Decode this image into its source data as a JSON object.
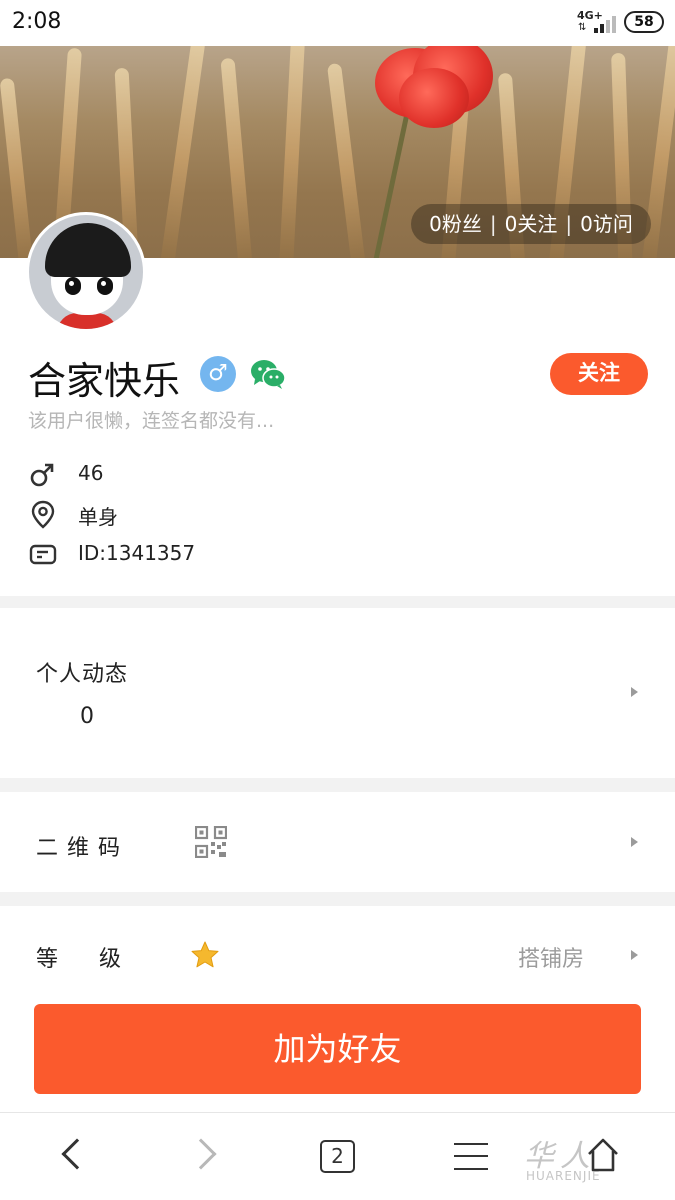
{
  "status_bar": {
    "time": "2:08",
    "network": "4G+",
    "network_arrows": "⇅",
    "battery": "58"
  },
  "profile": {
    "stats": {
      "fans": "0粉丝",
      "following": "0关注",
      "visits": "0访问",
      "separator": "|"
    },
    "name": "合家快乐",
    "gender_symbol": "♂",
    "follow_label": "关注",
    "signature": "该用户很懒，连签名都没有...",
    "age": "46",
    "location": "单身",
    "id_text": "ID:1341357"
  },
  "sections": {
    "activity": {
      "title": "个人动态",
      "count": "0"
    },
    "qr_code": {
      "title": "二 维 码"
    },
    "level": {
      "title": "等     级",
      "value": "搭铺房"
    }
  },
  "add_friend_label": "加为好友",
  "bottom_bar": {
    "tab_count": "2"
  },
  "watermark": {
    "main": "华人",
    "sub": "HUARENJIE"
  },
  "colors": {
    "accent": "#fb5a2d",
    "badge_blue": "#74b6ef",
    "wechat_green": "#2aae67"
  }
}
